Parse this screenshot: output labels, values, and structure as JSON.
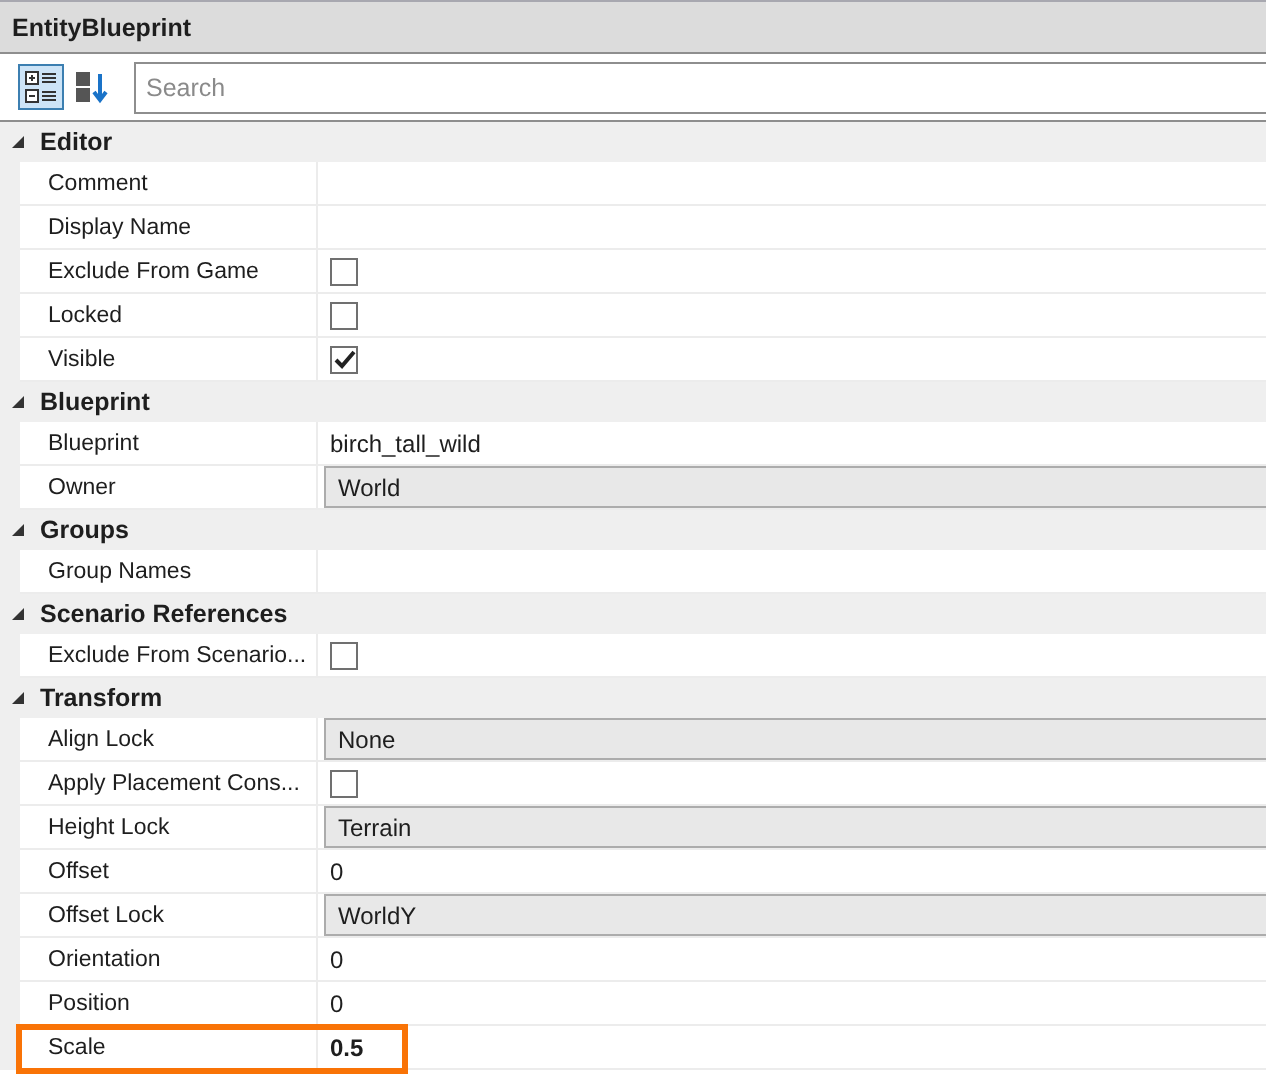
{
  "window": {
    "title": "EntityBlueprint"
  },
  "toolbar": {
    "categorized_selected": true,
    "alphabetical_selected": false,
    "search": {
      "placeholder": "Search"
    }
  },
  "categories": [
    {
      "name": "Editor",
      "expanded": true,
      "properties": [
        {
          "name": "Comment",
          "kind": "text"
        },
        {
          "name": "Display Name",
          "kind": "text"
        },
        {
          "name": "Exclude From Game",
          "kind": "checkbox",
          "checked": false
        },
        {
          "name": "Locked",
          "kind": "checkbox",
          "checked": false
        },
        {
          "name": "Visible",
          "kind": "checkbox",
          "checked": true
        }
      ]
    },
    {
      "name": "Blueprint",
      "expanded": true,
      "properties": [
        {
          "name": "Blueprint",
          "kind": "text",
          "value": "birch_tall_wild"
        },
        {
          "name": "Owner",
          "kind": "dropdown",
          "value": "World"
        }
      ]
    },
    {
      "name": "Groups",
      "expanded": true,
      "properties": [
        {
          "name": "Group Names",
          "kind": "text"
        }
      ]
    },
    {
      "name": "Scenario References",
      "expanded": true,
      "properties": [
        {
          "name": "Exclude From Scenario...",
          "kind": "checkbox",
          "checked": false
        }
      ]
    },
    {
      "name": "Transform",
      "expanded": true,
      "properties": [
        {
          "name": "Align Lock",
          "kind": "dropdown",
          "value": "None"
        },
        {
          "name": "Apply Placement Cons...",
          "kind": "checkbox",
          "checked": false
        },
        {
          "name": "Height Lock",
          "kind": "dropdown",
          "value": "Terrain"
        },
        {
          "name": "Offset",
          "kind": "text",
          "value": "0"
        },
        {
          "name": "Offset Lock",
          "kind": "dropdown",
          "value": "WorldY"
        },
        {
          "name": "Orientation",
          "kind": "text",
          "value": "0"
        },
        {
          "name": "Position",
          "kind": "text",
          "value": "0"
        },
        {
          "name": "Scale",
          "kind": "text",
          "value": "0.5",
          "modified": true,
          "highlighted": true
        }
      ]
    }
  ]
}
